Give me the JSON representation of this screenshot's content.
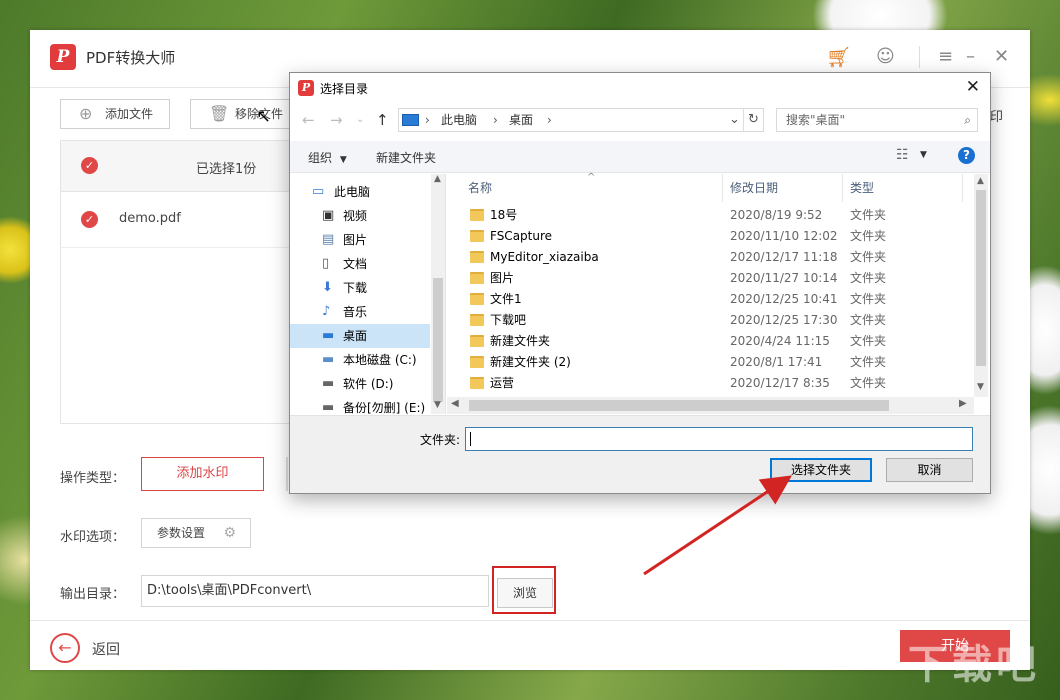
{
  "app": {
    "title": "PDF转换大师",
    "logo_glyph": "P"
  },
  "toolbar": {
    "add_file": "添加文件",
    "remove_file": "移除文件",
    "edge_text": "印"
  },
  "file_table": {
    "header_selected": "已选择1份",
    "rows": [
      {
        "name": "demo.pdf",
        "checked": true
      }
    ]
  },
  "form": {
    "op_type_label": "操作类型：",
    "op_type_value": "添加水印",
    "wm_options_label": "水印选项：",
    "wm_options_button": "参数设置",
    "output_label": "输出目录：",
    "output_path": "D:\\tools\\桌面\\PDFconvert\\",
    "browse": "浏览"
  },
  "bottom": {
    "back": "返回",
    "start": "开始"
  },
  "dialog": {
    "title": "选择目录",
    "address": {
      "root": "此电脑",
      "current": "桌面"
    },
    "search_placeholder": "搜索\"桌面\"",
    "commands": {
      "organize": "组织",
      "new_folder": "新建文件夹"
    },
    "tree": [
      {
        "label": "此电脑",
        "icon": "computer-icon",
        "glyph": "▭",
        "level": 0
      },
      {
        "label": "视频",
        "icon": "video-icon",
        "glyph": "▣",
        "level": 1
      },
      {
        "label": "图片",
        "icon": "pictures-icon",
        "glyph": "▤",
        "level": 1
      },
      {
        "label": "文档",
        "icon": "documents-icon",
        "glyph": "▯",
        "level": 1
      },
      {
        "label": "下载",
        "icon": "download-icon",
        "glyph": "⬇",
        "level": 1
      },
      {
        "label": "音乐",
        "icon": "music-icon",
        "glyph": "♪",
        "level": 1
      },
      {
        "label": "桌面",
        "icon": "desktop-icon",
        "glyph": "▬",
        "level": 1,
        "selected": true
      },
      {
        "label": "本地磁盘 (C:)",
        "icon": "drive-c-icon",
        "glyph": "▬",
        "level": 1
      },
      {
        "label": "软件 (D:)",
        "icon": "drive-d-icon",
        "glyph": "▬",
        "level": 1
      },
      {
        "label": "备份[勿删] (E:)",
        "icon": "drive-e-icon",
        "glyph": "▬",
        "level": 1
      }
    ],
    "columns": {
      "name": "名称",
      "date": "修改日期",
      "type": "类型"
    },
    "files": [
      {
        "name": "18号",
        "date": "2020/8/19 9:52",
        "type": "文件夹"
      },
      {
        "name": "FSCapture",
        "date": "2020/11/10 12:02",
        "type": "文件夹"
      },
      {
        "name": "MyEditor_xiazaiba",
        "date": "2020/12/17 11:18",
        "type": "文件夹"
      },
      {
        "name": "图片",
        "date": "2020/11/27 10:14",
        "type": "文件夹"
      },
      {
        "name": "文件1",
        "date": "2020/12/25 10:41",
        "type": "文件夹"
      },
      {
        "name": "下载吧",
        "date": "2020/12/25 17:30",
        "type": "文件夹"
      },
      {
        "name": "新建文件夹",
        "date": "2020/4/24 11:15",
        "type": "文件夹"
      },
      {
        "name": "新建文件夹 (2)",
        "date": "2020/8/1 17:41",
        "type": "文件夹"
      },
      {
        "name": "运营",
        "date": "2020/12/17 8:35",
        "type": "文件夹"
      }
    ],
    "folder_label": "文件夹:",
    "folder_value": "",
    "select_button": "选择文件夹",
    "cancel_button": "取消"
  },
  "colors": {
    "accent": "#e04848",
    "highlight": "#d32424",
    "primary_border": "#0078d7"
  },
  "watermark": "下载吧"
}
